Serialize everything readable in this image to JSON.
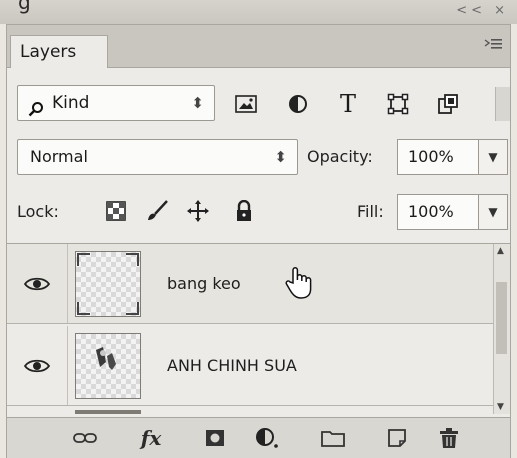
{
  "top_fragment": "g",
  "top_controls": "<< ×",
  "panel": {
    "tab_label": "Layers",
    "menu_icon": "panel-menu-icon"
  },
  "filter": {
    "kind_label": "Kind",
    "icons": [
      "image-filter-icon",
      "adjustment-filter-icon",
      "type-filter-icon",
      "shape-filter-icon",
      "smart-object-filter-icon"
    ],
    "type_glyph": "T"
  },
  "blend": {
    "mode": "Normal",
    "opacity_label": "Opacity:",
    "opacity_value": "100%"
  },
  "lock": {
    "label": "Lock:",
    "icons": [
      "lock-transparent-pixels-icon",
      "lock-image-pixels-icon",
      "lock-position-icon",
      "lock-all-icon"
    ],
    "fill_label": "Fill:",
    "fill_value": "100%"
  },
  "layers": [
    {
      "name": "bang keo",
      "visible": true,
      "selected": false
    },
    {
      "name": "ANH CHINH SUA",
      "visible": true,
      "selected": false
    }
  ],
  "bottom_bar": {
    "icons": [
      "link-layers-icon",
      "layer-style-icon",
      "layer-mask-icon",
      "adjustment-layer-icon",
      "new-group-icon",
      "new-layer-icon",
      "delete-layer-icon"
    ],
    "fx_label": "fx"
  },
  "colors": {
    "panel_bg": "#ecebe7",
    "tab_bar_bg": "#c9c6c0",
    "field_bg": "#fbfbfa",
    "border": "#9c9993"
  }
}
